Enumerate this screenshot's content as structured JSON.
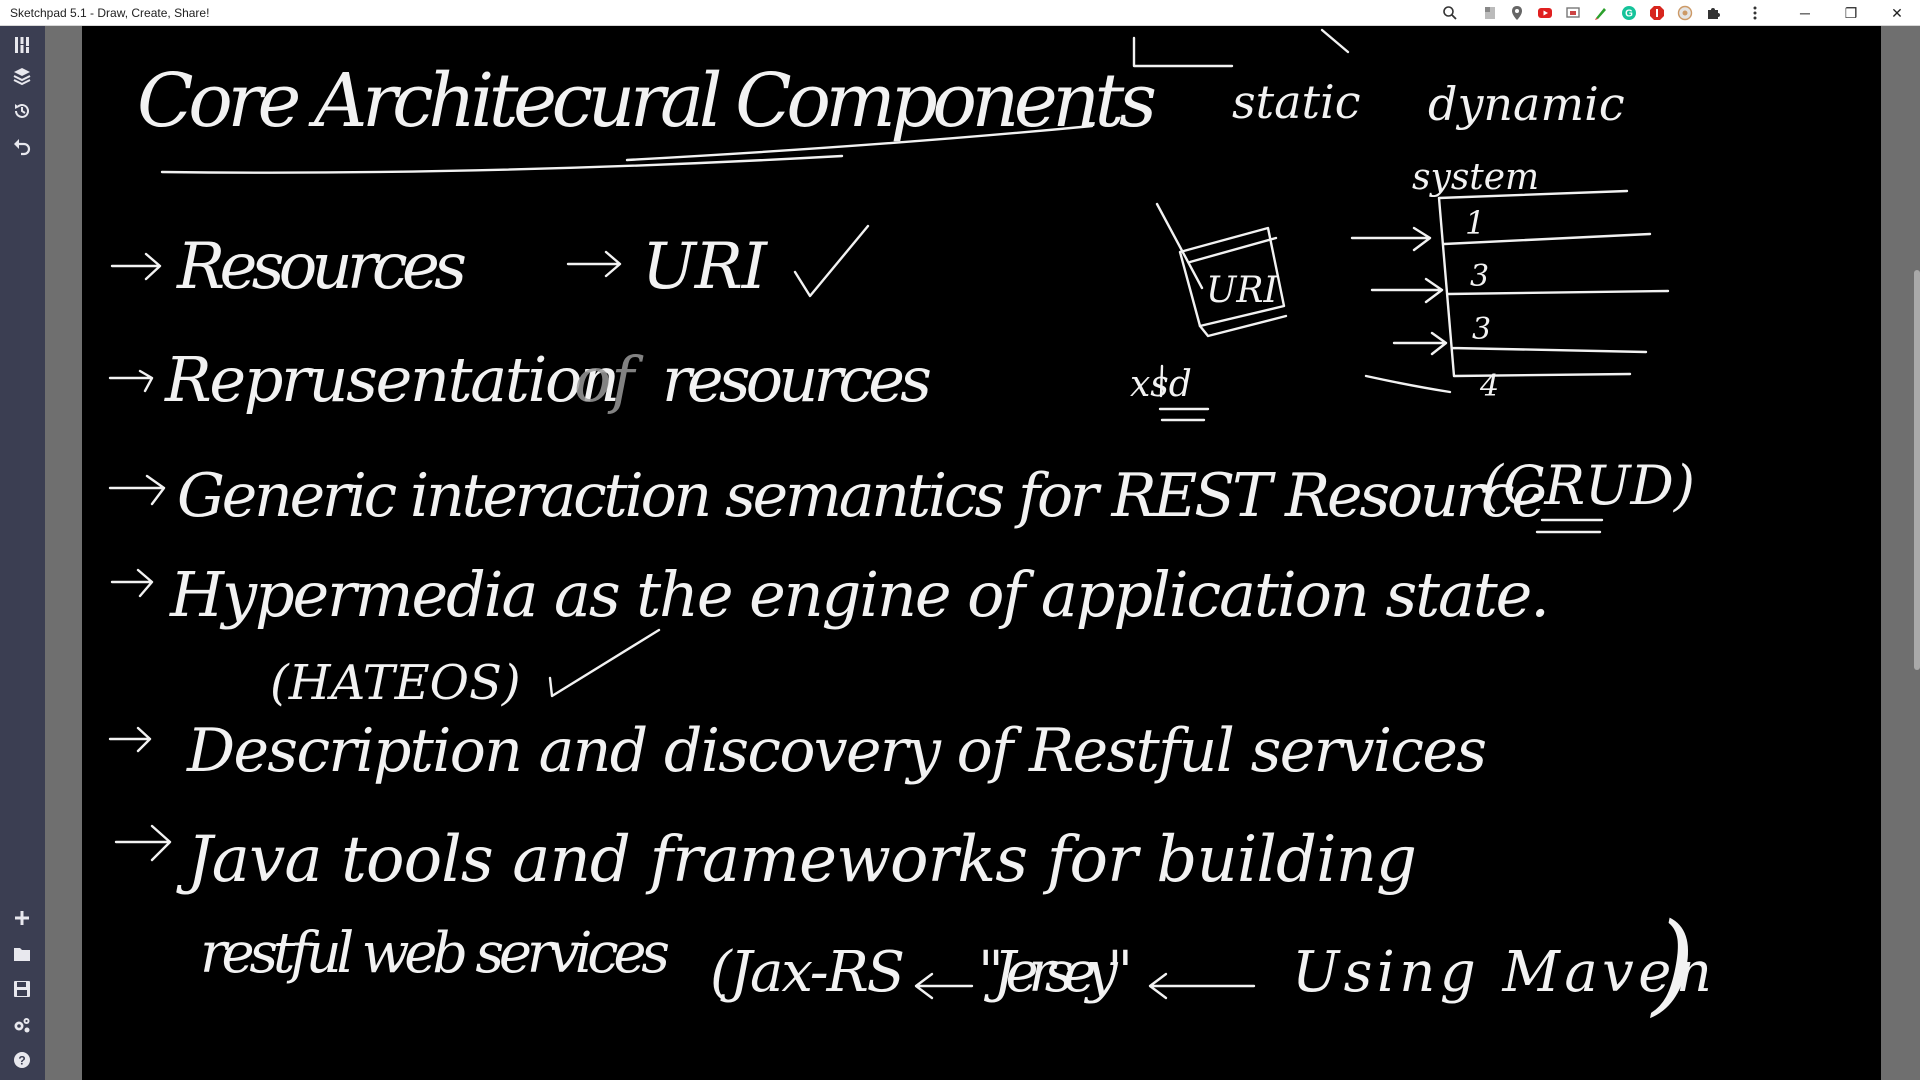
{
  "window": {
    "title": "Sketchpad 5.1 - Draw, Create, Share!",
    "controls": {
      "minimize": "─",
      "restore": "❐",
      "close": "✕"
    }
  },
  "toolbar_icons": [
    "brush-icon",
    "layers-icon",
    "history-icon",
    "undo-icon",
    "add-icon",
    "folder-icon",
    "save-icon",
    "settings-icon",
    "help-icon"
  ],
  "browser_icons": [
    "zoom-icon",
    "extension-icon",
    "location-icon",
    "youtube-icon",
    "screen-icon",
    "pen-icon",
    "grammarly-icon",
    "adblock-icon",
    "extension-icon",
    "puzzle-icon",
    "more-icon"
  ],
  "notes": {
    "title": "Core Architecural Components",
    "line1_a": "Resources",
    "line1_b": "URI",
    "line2_a": "Reprusentation",
    "line2_b": "of",
    "line2_c": "resources",
    "line3_a": "Generic interaction semantics for REST Resource",
    "line3_b": "(CRUD)",
    "line4_a": "Hypermedia as the engine of application state.",
    "line4_b": "(HATEOS)",
    "line5": "Description and discovery of Restful services",
    "line6_a": "Java tools and frameworks for building",
    "line6_b": "restful web services",
    "line6_c": "(Jax-RS",
    "line6_d": "\"Jersey\"",
    "line6_e": "Using Maven",
    "line6_f": ")",
    "diagram_uri": "URI",
    "diagram_xsd": "xsd",
    "diagram_static": "static",
    "diagram_dynamic": "dynamic",
    "diagram_system": "system",
    "rows": [
      "1",
      "3",
      "3",
      "4"
    ]
  }
}
